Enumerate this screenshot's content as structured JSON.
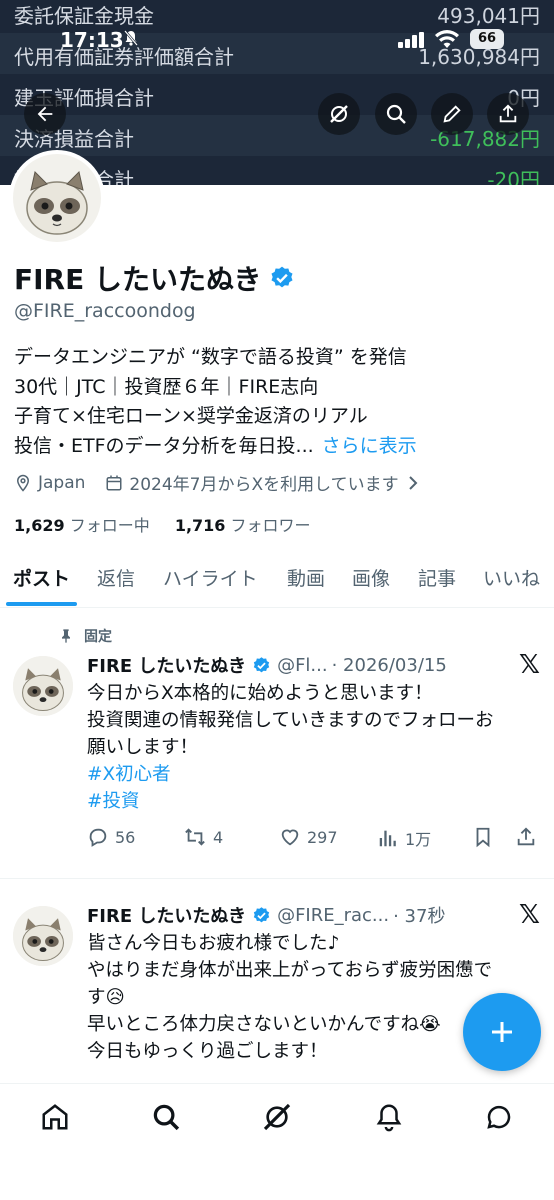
{
  "banner": {
    "rows": [
      {
        "label": "委託保証金現金",
        "value": "493,041円",
        "negative": false
      },
      {
        "label": "代用有価証券評価額合計",
        "value": "1,630,984円",
        "negative": false
      },
      {
        "label": "建玉評価損合計",
        "value": "0円",
        "negative": false
      },
      {
        "label": "決済損益合計",
        "value": "-617,882円",
        "negative": true
      },
      {
        "label": "諸経費等合計",
        "value": "-20円",
        "negative": true
      }
    ]
  },
  "status_bar": {
    "time": "17:13",
    "battery": "66"
  },
  "profile": {
    "name": "FIRE したいたぬき",
    "handle": "@FIRE_raccoondog",
    "bio_lines": [
      "データエンジニアが “数字で語る投資” を発信",
      "30代｜JTC｜投資歴６年｜FIRE志向",
      "子育て×住宅ローン×奨学金返済のリアル",
      "投信・ETFのデータ分析を毎日投..."
    ],
    "bio_more": "さらに表示",
    "location": "Japan",
    "joined": "2024年7月からXを利用しています",
    "following_count": "1,629",
    "following_label": "フォロー中",
    "followers_count": "1,716",
    "followers_label": "フォロワー"
  },
  "tabs": [
    "ポスト",
    "返信",
    "ハイライト",
    "動画",
    "画像",
    "記事",
    "いいね"
  ],
  "pinned_label": "固定",
  "posts": [
    {
      "name": "FIRE したいたぬき",
      "handle": "@Fl...",
      "time": "· 2026/03/15",
      "lines": [
        "今日からX本格的に始めようと思います！",
        "投資関連の情報発信していきますのでフォローお",
        "願いします！"
      ],
      "tags": [
        "#X初心者",
        "#投資"
      ],
      "replies": "56",
      "reposts": "4",
      "likes": "297",
      "views": "1万"
    },
    {
      "name": "FIRE したいたぬき",
      "handle": "@FIRE_rac...",
      "time": "· 37秒",
      "lines": [
        "皆さん今日もお疲れ様でした♪",
        "やはりまだ身体が出来上がっておらず疲労困憊で",
        "す😥",
        "早いところ体力戻さないといかんですね😭",
        "今日もゆっくり過ごします！"
      ]
    }
  ],
  "colors": {
    "accent": "#1d9bf0",
    "negative": "#3fbf5a",
    "text": "#0f1419",
    "muted": "#536471"
  }
}
